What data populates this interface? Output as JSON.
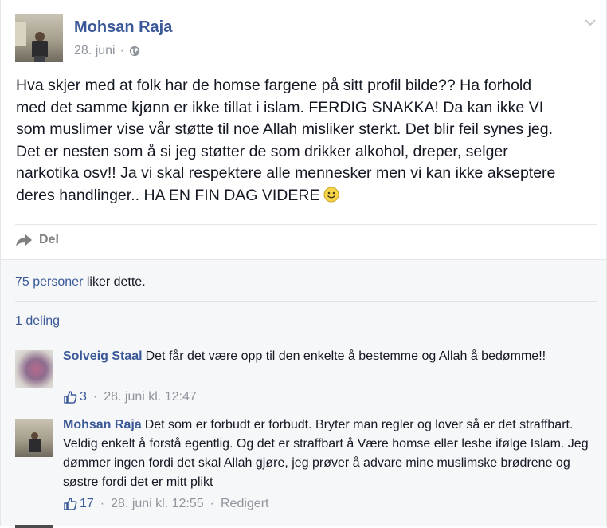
{
  "post": {
    "author": "Mohsan Raja",
    "date": "28. juni",
    "separator": "·",
    "audience_icon": "globe-icon",
    "text": "Hva skjer med at folk har de homse fargene på sitt profil bilde?? Ha forhold\nmed det samme kjønn er ikke tillat i islam. FERDIG SNAKKA! Da kan ikke VI\nsom muslimer vise vår støtte til noe Allah misliker sterkt. Det blir feil synes jeg.\nDet er nesten som å si jeg støtter de som drikker alkohol, dreper, selger\nnarkotika osv!! Ja vi skal respektere alle mennesker men vi kan ikke akseptere\nderes handlinger.. HA EN FIN DAG VIDERE",
    "emoji": "smiley-emoji"
  },
  "actions": {
    "share_label": "Del",
    "share_icon": "share-arrow-icon"
  },
  "feedback": {
    "likes_link": "75 personer",
    "likes_suffix": " liker dette.",
    "shares": "1 deling"
  },
  "comments": [
    {
      "author": "Solveig Staal",
      "text": "Det får det være opp til den enkelte å bestemme og Allah å bedømme!!",
      "like_count": "3",
      "separator": "·",
      "timestamp": "28. juni kl. 12:47",
      "edited": ""
    },
    {
      "author": "Mohsan Raja",
      "text": "Det som er forbudt er forbudt. Bryter man regler og lover så er det straffbart. Veldig enkelt å forstå egentlig. Og det er straffbart å Være homse eller lesbe ifølge Islam. Jeg dømmer ingen fordi det skal Allah gjøre, jeg prøver å advare mine muslimske brødrene og søstre fordi det er mitt plikt",
      "like_count": "17",
      "separator": "·",
      "timestamp": "28. juni kl. 12:55",
      "edited": "Redigert"
    }
  ],
  "colors": {
    "link": "#3b5998",
    "meta": "#90949c",
    "text": "#141823",
    "feedback_bg": "#f6f7f9"
  }
}
